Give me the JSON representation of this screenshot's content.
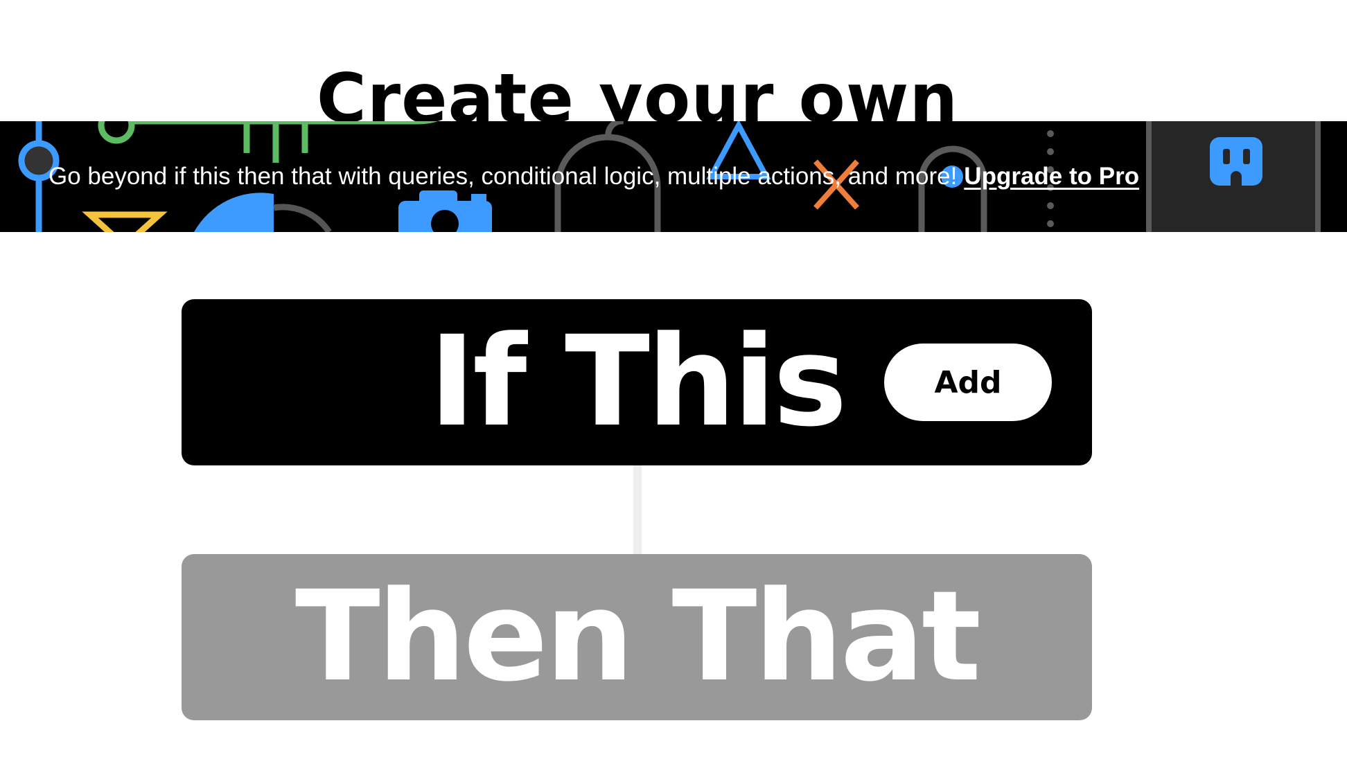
{
  "header": {
    "title": "Create your own"
  },
  "promo": {
    "text": "Go beyond if this then that with queries, conditional logic, multiple actions, and more!",
    "link_label": "Upgrade to Pro"
  },
  "applet": {
    "trigger_label": "If This",
    "trigger_button": "Add",
    "action_label": "Then That"
  },
  "colors": {
    "accent_blue": "#3d9bff",
    "accent_green": "#5dbb63",
    "accent_yellow": "#f5c33b",
    "accent_orange": "#f07d3a",
    "disabled_gray": "#999999"
  }
}
